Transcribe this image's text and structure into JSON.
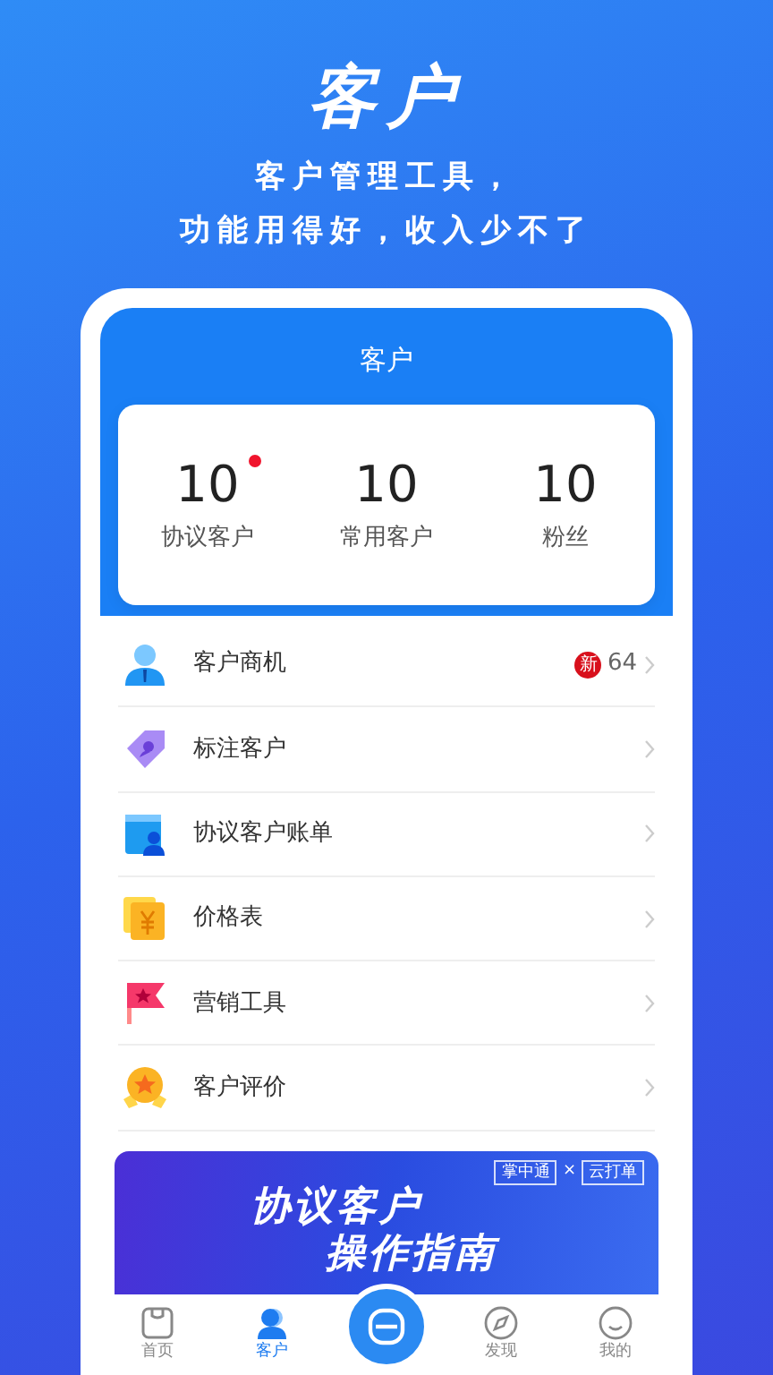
{
  "promo": {
    "title": "客户",
    "lines": [
      "客户管理工具，",
      "功能用得好，收入少不了"
    ]
  },
  "screen": {
    "title": "客户",
    "stats": [
      {
        "value": "10",
        "label": "协议客户",
        "dot": true
      },
      {
        "value": "10",
        "label": "常用客户",
        "dot": false
      },
      {
        "value": "10",
        "label": "粉丝",
        "dot": false
      }
    ],
    "menu": [
      {
        "kind": "person",
        "label": "客户商机",
        "badge": "新",
        "count": "64"
      },
      {
        "kind": "tag",
        "label": "标注客户"
      },
      {
        "kind": "bill",
        "label": "协议客户账单"
      },
      {
        "kind": "price",
        "label": "价格表"
      },
      {
        "kind": "flag",
        "label": "营销工具"
      },
      {
        "kind": "medal",
        "label": "客户评价"
      }
    ],
    "banner": {
      "tags": [
        "掌中通",
        "×",
        "云打单"
      ],
      "line1": "协议客户",
      "line2": "操作指南"
    },
    "tabs": [
      {
        "kind": "home",
        "label": "首页",
        "selected": false
      },
      {
        "kind": "customer",
        "label": "客户",
        "selected": true
      },
      {
        "kind": "scan"
      },
      {
        "kind": "discover",
        "label": "发现",
        "selected": false
      },
      {
        "kind": "me",
        "label": "我的",
        "selected": false
      }
    ]
  }
}
